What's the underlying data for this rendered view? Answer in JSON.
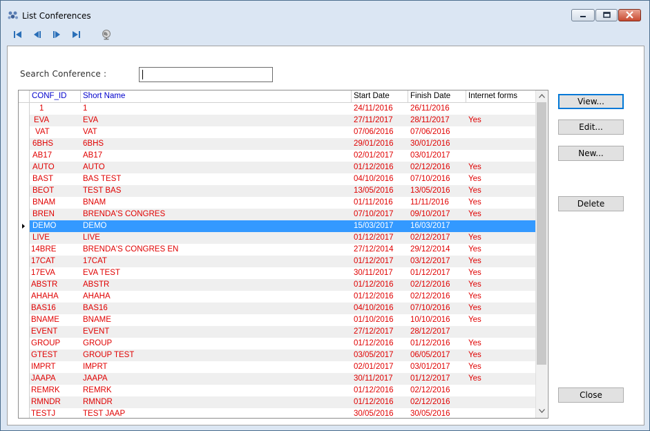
{
  "window": {
    "title": "List Conferences"
  },
  "toolbar": {
    "buttons": [
      {
        "name": "first-record-icon"
      },
      {
        "name": "previous-record-icon"
      },
      {
        "name": "next-record-icon"
      },
      {
        "name": "last-record-icon"
      },
      {
        "name": "globe-icon"
      }
    ]
  },
  "search": {
    "label": "Search Conference :",
    "value": ""
  },
  "grid": {
    "columns": [
      "CONF_ID",
      "Short Name",
      "Start Date",
      "Finish Date",
      "Internet forms"
    ],
    "selected_index": 10,
    "rows": [
      [
        "1",
        "1",
        "24/11/2016",
        "26/11/2016",
        ""
      ],
      [
        "EVA",
        "EVA",
        "27/11/2017",
        "28/11/2017",
        "Yes"
      ],
      [
        "VAT",
        "VAT",
        "07/06/2016",
        "07/06/2016",
        ""
      ],
      [
        "6BHS",
        "6BHS",
        "29/01/2016",
        "30/01/2016",
        ""
      ],
      [
        "AB17",
        "AB17",
        "02/01/2017",
        "03/01/2017",
        ""
      ],
      [
        "AUTO",
        "AUTO",
        "01/12/2016",
        "02/12/2016",
        "Yes"
      ],
      [
        "BAST",
        "BAS TEST",
        "04/10/2016",
        "07/10/2016",
        "Yes"
      ],
      [
        "BEOT",
        "TEST BAS",
        "13/05/2016",
        "13/05/2016",
        "Yes"
      ],
      [
        "BNAM",
        "BNAM",
        "01/11/2016",
        "11/11/2016",
        "Yes"
      ],
      [
        "BREN",
        "BRENDA'S CONGRES",
        "07/10/2017",
        "09/10/2017",
        "Yes"
      ],
      [
        "DEMO",
        "DEMO",
        "15/03/2017",
        "16/03/2017",
        ""
      ],
      [
        "LIVE",
        "LIVE",
        "01/12/2017",
        "02/12/2017",
        "Yes"
      ],
      [
        "14BRE",
        "BRENDA'S CONGRES EN",
        "27/12/2014",
        "29/12/2014",
        "Yes"
      ],
      [
        "17CAT",
        "17CAT",
        "01/12/2017",
        "03/12/2017",
        "Yes"
      ],
      [
        "17EVA",
        "EVA TEST",
        "30/11/2017",
        "01/12/2017",
        "Yes"
      ],
      [
        "ABSTR",
        "ABSTR",
        "01/12/2016",
        "02/12/2016",
        "Yes"
      ],
      [
        "AHAHA",
        "AHAHA",
        "01/12/2016",
        "02/12/2016",
        "Yes"
      ],
      [
        "BAS16",
        "BAS16",
        "04/10/2016",
        "07/10/2016",
        "Yes"
      ],
      [
        "BNAME",
        "BNAME",
        "01/10/2016",
        "10/10/2016",
        "Yes"
      ],
      [
        "EVENT",
        "EVENT",
        "27/12/2017",
        "28/12/2017",
        ""
      ],
      [
        "GROUP",
        "GROUP",
        "01/12/2016",
        "01/12/2016",
        "Yes"
      ],
      [
        "GTEST",
        "GROUP TEST",
        "03/05/2017",
        "06/05/2017",
        "Yes"
      ],
      [
        "IMPRT",
        "IMPRT",
        "02/01/2017",
        "03/01/2017",
        "Yes"
      ],
      [
        "JAAPA",
        "JAAPA",
        "30/11/2017",
        "01/12/2017",
        "Yes"
      ],
      [
        "REMRK",
        "REMRK",
        "01/12/2016",
        "02/12/2016",
        ""
      ],
      [
        "RMNDR",
        "RMNDR",
        "01/12/2016",
        "02/12/2016",
        ""
      ],
      [
        "TESTJ",
        "TEST JAAP",
        "30/05/2016",
        "30/05/2016",
        ""
      ]
    ]
  },
  "actions": {
    "view": "View...",
    "edit": "Edit...",
    "new": "New...",
    "delete": "Delete",
    "close": "Close"
  },
  "colors": {
    "row_text": "#e00000",
    "selection": "#3399ff",
    "header_text": "#0000cc"
  }
}
